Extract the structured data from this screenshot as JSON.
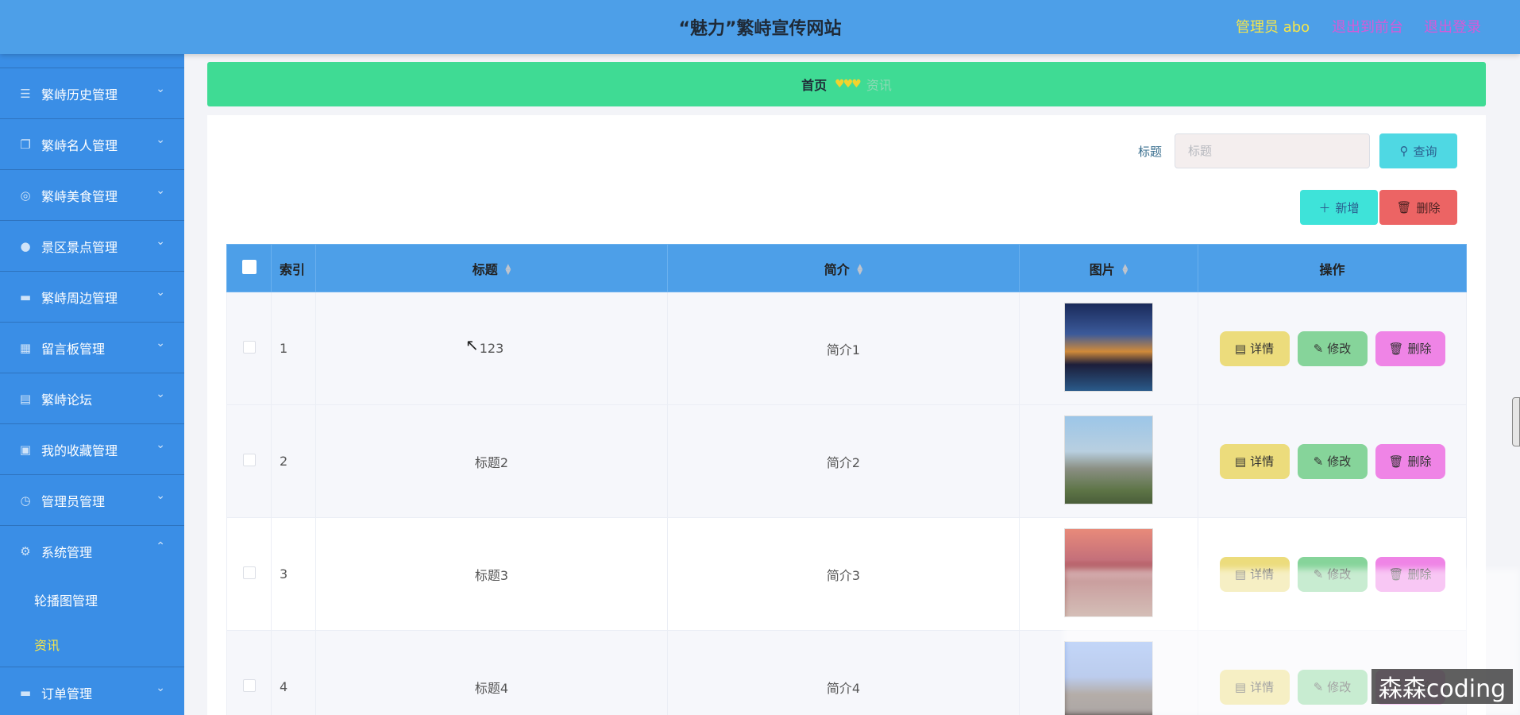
{
  "header": {
    "site_title": "“魅力”繁峙宣传网站",
    "admin_user": "管理员 abo",
    "to_front": "退出到前台",
    "logout": "退出登录"
  },
  "sidebar": {
    "items": [
      {
        "label": "繁峙历史管理",
        "icon": "list-icon"
      },
      {
        "label": "繁峙名人管理",
        "icon": "copy-icon"
      },
      {
        "label": "繁峙美食管理",
        "icon": "compass-icon"
      },
      {
        "label": "景区景点管理",
        "icon": "user-icon"
      },
      {
        "label": "繁峙周边管理",
        "icon": "monitor-icon"
      },
      {
        "label": "留言板管理",
        "icon": "building-icon"
      },
      {
        "label": "繁峙论坛",
        "icon": "clipboard-icon"
      },
      {
        "label": "我的收藏管理",
        "icon": "picture-icon"
      },
      {
        "label": "管理员管理",
        "icon": "clock-icon"
      },
      {
        "label": "系统管理",
        "icon": "gear-icon"
      }
    ],
    "sub_items": [
      {
        "label": "轮播图管理"
      },
      {
        "label": "资讯"
      }
    ],
    "last_item": {
      "label": "订单管理",
      "icon": "monitor-icon"
    }
  },
  "breadcrumb": {
    "home": "首页",
    "hearts": "♥♥♥",
    "current": "资讯"
  },
  "search": {
    "label": "标题",
    "placeholder": "标题",
    "query_button": "查询"
  },
  "actions": {
    "add_button": "新增",
    "delete_button": "删除"
  },
  "table": {
    "headers": {
      "index": "索引",
      "title": "标题",
      "intro": "简介",
      "image": "图片",
      "ops": "操作"
    },
    "op_labels": {
      "detail": "详情",
      "edit": "修改",
      "delete": "删除"
    },
    "rows": [
      {
        "index": "1",
        "title": "123",
        "intro": "简介1"
      },
      {
        "index": "2",
        "title": "标题2",
        "intro": "简介2"
      },
      {
        "index": "3",
        "title": "标题3",
        "intro": "简介3"
      },
      {
        "index": "4",
        "title": "标题4",
        "intro": "简介4"
      }
    ]
  },
  "watermark": "森森coding"
}
